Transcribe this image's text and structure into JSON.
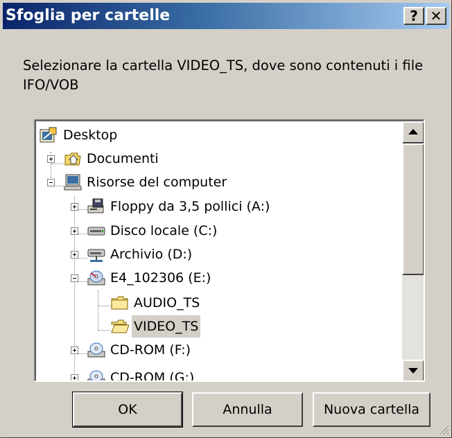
{
  "window": {
    "title": "Sfoglia per cartelle",
    "help_label": "?",
    "close_label": "✕"
  },
  "instruction": "Selezionare la cartella VIDEO_TS, dove sono contenuti i file IFO/VOB",
  "tree": {
    "items": [
      {
        "label": "Desktop",
        "icon": "desktop-icon"
      },
      {
        "label": "Documenti",
        "icon": "my-documents-folder-icon"
      },
      {
        "label": "Risorse del computer",
        "icon": "my-computer-icon"
      },
      {
        "label": "Floppy da 3,5 pollici (A:)",
        "icon": "floppy-drive-icon"
      },
      {
        "label": "Disco locale (C:)",
        "icon": "hard-drive-icon"
      },
      {
        "label": "Archivio (D:)",
        "icon": "network-drive-icon"
      },
      {
        "label": "E4_102306 (E:)",
        "icon": "dvd-drive-icon"
      },
      {
        "label": "AUDIO_TS",
        "icon": "folder-icon"
      },
      {
        "label": "VIDEO_TS",
        "icon": "open-folder-icon",
        "selected": true
      },
      {
        "label": "CD-ROM (F:)",
        "icon": "cd-drive-icon"
      },
      {
        "label": "CD-ROM (G:)",
        "icon": "cd-drive-icon"
      }
    ]
  },
  "buttons": {
    "ok": "OK",
    "cancel": "Annulla",
    "new_folder": "Nuova cartella"
  }
}
